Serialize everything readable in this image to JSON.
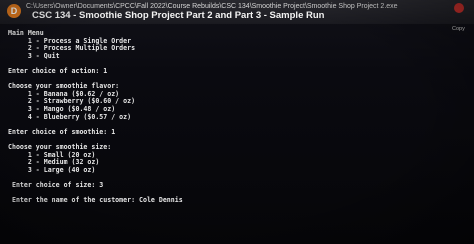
{
  "window": {
    "avatar_letter": "D",
    "path": "C:\\Users\\Owner\\Documents\\CPCC\\Fall 2022\\Course Rebuilds\\CSC 134\\Smoothie Project\\Smoothie Shop Project 2.exe",
    "overlay_title": "CSC 134 - Smoothie Shop Project Part 2 and Part 3 - Sample Run",
    "copy_label": "Copy"
  },
  "console": {
    "menu_title": "Main Menu",
    "menu_items": [
      "     1 - Process a Single Order",
      "     2 - Process Multiple Orders",
      "     3 - Quit"
    ],
    "action_prompt": "Enter choice of action: 1",
    "flavor_header": "Choose your smoothie flavor:",
    "flavors": [
      "     1 - Banana ($0.62 / oz)",
      "     2 - Strawberry ($0.60 / oz)",
      "     3 - Mango ($0.48 / oz)",
      "     4 - Blueberry ($0.57 / oz)"
    ],
    "smoothie_prompt": "Enter choice of smoothie: 1",
    "size_header": "Choose your smoothie size:",
    "sizes": [
      "     1 - Small (20 oz)",
      "     2 - Medium (32 oz)",
      "     3 - Large (40 oz)"
    ],
    "size_prompt": " Enter choice of size: 3",
    "name_prompt": " Enter the name of the customer: Cole Dennis"
  }
}
